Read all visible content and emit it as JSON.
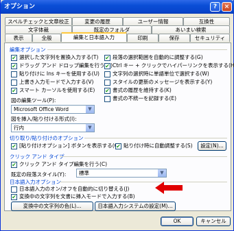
{
  "window": {
    "title": "オプション",
    "help": "?",
    "close": "×"
  },
  "tabs_row1": [
    "スペルチェックと文章校正",
    "変更の履歴",
    "ユーザー情報",
    "互換性"
  ],
  "tabs_row2": [
    "文字体裁",
    "既定のフォルダ",
    "あいまい検索"
  ],
  "tabs_row3": [
    "表示",
    "全般",
    "編集と日本語入力",
    "印刷",
    "保存",
    "セキュリティ"
  ],
  "active_tab": "編集と日本語入力",
  "edit": {
    "heading": "編集オプション",
    "left": [
      {
        "label": "選択した文字列を置換入力する(T)",
        "checked": true
      },
      {
        "label": "ドラッグ アンド ドロップ編集を行う(D)",
        "checked": true
      },
      {
        "label": "貼り付けに Ins キーを使用する(U)",
        "checked": false
      },
      {
        "label": "上書き入力モードで入力する(V)",
        "checked": false
      },
      {
        "label": "スマート カーソルを使用する(E)",
        "checked": true
      }
    ],
    "right": [
      {
        "label": "段落の選択範囲を自動的に調整する(G)",
        "checked": true
      },
      {
        "label": "Ctrl キー + クリックでハイパーリンクを表示する(H)",
        "checked": true
      },
      {
        "label": "文字列の選択時に単語単位で選択する(W)",
        "checked": false
      },
      {
        "label": "スタイルの更新のメッセージを表示する(Y)",
        "checked": false
      },
      {
        "label": "書式の履歴を維持する(K)",
        "checked": true
      },
      {
        "label": "書式の不統一を記録する(E)",
        "checked": false
      }
    ],
    "picture_editor_label": "図の編集ツール(P):",
    "picture_editor_value": "Microsoft Office Word",
    "paste_style_label": "図を挿入/貼り付ける形式(I):",
    "paste_style_value": "行内"
  },
  "paste": {
    "heading": "切り取り/貼り付けのオプション",
    "opt1": {
      "label": "[貼り付けオプション] ボタンを表示する(O)",
      "checked": true
    },
    "opt2": {
      "label": "貼り付け時に自動調整する(S)",
      "checked": true
    },
    "settings_button": "設定(N)..."
  },
  "click_type": {
    "heading": "クリック アンド タイプ",
    "opt": {
      "label": "クリック アンド タイプ編集を行う(C)",
      "checked": true
    },
    "style_label": "既定の段落スタイル(Y):",
    "style_value": "標準"
  },
  "ime": {
    "heading": "日本語入力オプション",
    "opt1": {
      "label": "日本語入力のオン/オフを自動的に切り替える(J)",
      "checked": false
    },
    "opt2": {
      "label": "変換中の文字列を文書に挿入モードで入力する(B)",
      "checked": true
    },
    "color_button": "変換中の文字列の色(L)...",
    "ime_button": "日本語入力システムの設定(M)..."
  },
  "footer": {
    "ok": "OK",
    "cancel": "キャンセル"
  },
  "colors": {
    "titlebar": "#0A4ED6",
    "dialog_bg": "#ECE9D8",
    "section_text": "#0046D5",
    "arrow": "#E00000"
  },
  "icons": {
    "check": "✔",
    "dropdown": "chevron-down-icon",
    "annotation": "red-arrow-icon"
  }
}
